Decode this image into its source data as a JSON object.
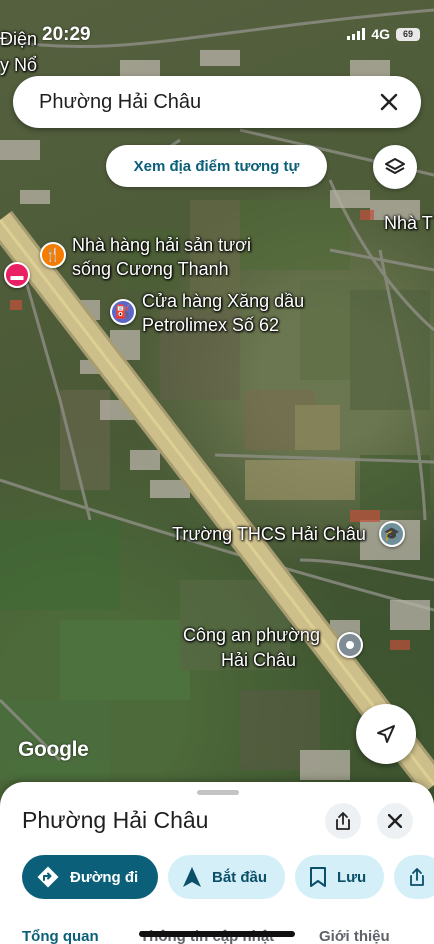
{
  "status_bar": {
    "time": "20:29",
    "network": "4G",
    "battery": "69"
  },
  "search": {
    "title": "Phường Hải Châu",
    "close_icon": "close-icon"
  },
  "map": {
    "similar_places_button": "Xem địa điểm tương tự",
    "labels": {
      "top_left_1": "Điện",
      "top_left_2": "y Nổ",
      "top_right": "Nhà T",
      "restaurant": [
        "Nhà hàng hải sản tươi",
        "sống Cương Thanh"
      ],
      "gas_station": [
        "Cửa hàng Xăng dầu",
        "Petrolimex Số 62"
      ],
      "school": "Trường THCS Hải Châu",
      "police": [
        "Công an phường",
        "Hải Châu"
      ]
    },
    "google_logo": "Google"
  },
  "sheet": {
    "title": "Phường Hải Châu",
    "actions": [
      {
        "label": "Đường đi",
        "icon": "directions-icon"
      },
      {
        "label": "Bắt đầu",
        "icon": "navigation-arrow-icon"
      },
      {
        "label": "Lưu",
        "icon": "bookmark-icon"
      }
    ],
    "tabs": [
      "Tổng quan",
      "Thông tin cập nhật",
      "Giới thiệu"
    ]
  },
  "colors": {
    "accent": "#0b5f78",
    "chip_bg": "#d4eff8"
  }
}
